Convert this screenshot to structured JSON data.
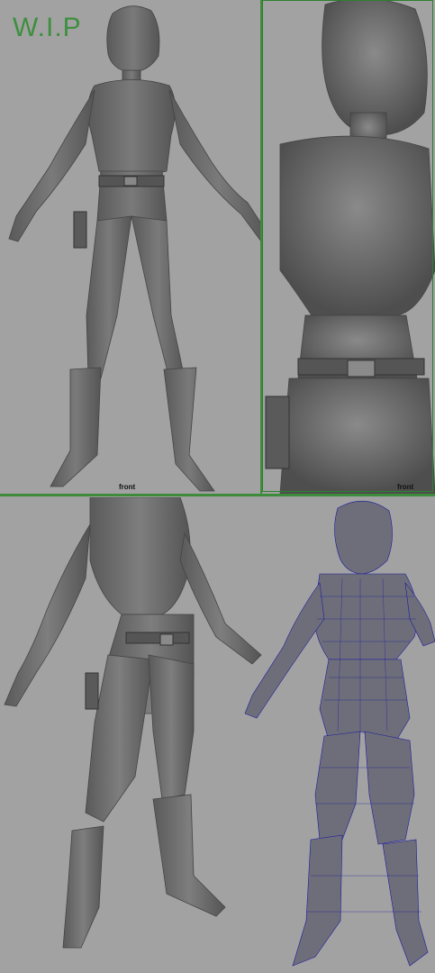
{
  "title": "W.I.P",
  "viewports": [
    {
      "id": "front",
      "camera_label": "front"
    },
    {
      "id": "closeup",
      "camera_label": "front"
    },
    {
      "id": "perspective-shaded"
    },
    {
      "id": "perspective-wireframe"
    }
  ],
  "colors": {
    "background": "#a2a2a2",
    "model_fill": "#6a6a6a",
    "model_shadow": "#4a4a4a",
    "viewport_border": "#3c8c3c",
    "wireframe": "#1a1aa0",
    "title": "#3f8f3f"
  }
}
